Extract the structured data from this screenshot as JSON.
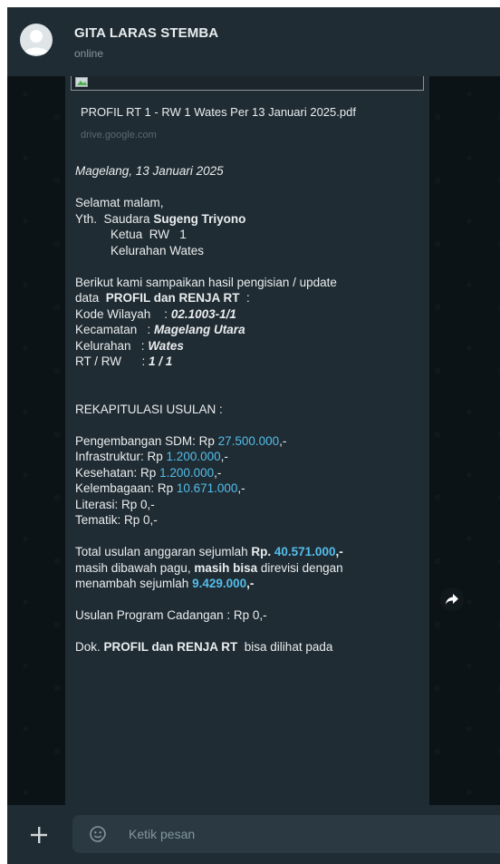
{
  "header": {
    "contact_name": "GITA LARAS STEMBA",
    "status": "online"
  },
  "message": {
    "link_title": "PROFIL RT 1 - RW 1 Wates Per 13 Januari 2025.pdf",
    "link_domain": "drive.google.com",
    "date_line": "Magelang, 13 Januari 2025",
    "greeting": "Selamat malam,",
    "yth_prefix": "Yth.  Saudara ",
    "recipient_name": "Sugeng Triyono",
    "recipient_role": "Ketua  RW   1",
    "recipient_kelurahan": "Kelurahan Wates",
    "intro_line1": "Berikut kami sampaikan hasil pengisian / update",
    "intro_line2_prefix": "data  ",
    "intro_line2_bold": "PROFIL dan RENJA RT",
    "intro_line2_suffix": "  :",
    "kode_label": "Kode Wilayah    : ",
    "kode_value": "02.1003-1/1",
    "kecamatan_label": "Kecamatan   : ",
    "kecamatan_value": "Magelang Utara",
    "kelurahan_label": "Kelurahan   : ",
    "kelurahan_value": "Wates",
    "rtrw_label": "RT / RW      : ",
    "rtrw_value": "1 / 1",
    "rekap_heading": "REKAPITULASI USULAN :",
    "items": [
      {
        "label": "Pengembangan SDM: Rp ",
        "amount": "27.500.000",
        "suffix": ",-"
      },
      {
        "label": "Infrastruktur: Rp ",
        "amount": "1.200.000",
        "suffix": ",-"
      },
      {
        "label": "Kesehatan: Rp ",
        "amount": "1.200.000",
        "suffix": ",-"
      },
      {
        "label": "Kelembagaan: Rp ",
        "amount": "10.671.000",
        "suffix": ",-"
      },
      {
        "label": "Literasi: Rp 0,-",
        "amount": "",
        "suffix": ""
      },
      {
        "label": "Tematik: Rp 0,-",
        "amount": "",
        "suffix": ""
      }
    ],
    "total_prefix": "Total usulan anggaran sejumlah ",
    "total_rp": "Rp. ",
    "total_amount": "40.571.000",
    "total_suffix": ",-",
    "pagu_prefix": "masih dibawah pagu, ",
    "pagu_bold": "masih bisa",
    "pagu_suffix": " direvisi dengan",
    "tambah_prefix": "menambah sejumlah ",
    "tambah_amount": "9.429.000",
    "tambah_suffix": ",-",
    "cadangan": "Usulan Program Cadangan : Rp 0,-",
    "dok_prefix": "Dok. ",
    "dok_bold": "PROFIL dan RENJA RT",
    "dok_suffix": "  bisa dilihat pada"
  },
  "footer": {
    "input_placeholder": "Ketik pesan"
  },
  "icons": {
    "plus": "plus-icon",
    "emoji": "emoji-icon",
    "forward": "forward-icon",
    "avatar": "default-avatar-icon"
  },
  "colors": {
    "header_bg": "#202c33",
    "bubble_bg": "#202c33",
    "link_blue": "#53bdeb",
    "text": "#e9edef",
    "muted": "#8696a0"
  }
}
